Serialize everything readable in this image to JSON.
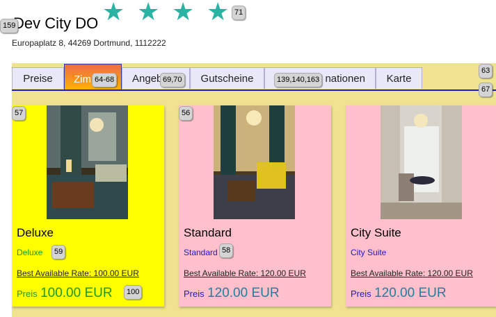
{
  "hotel": {
    "name": "Dev City DO",
    "address": "Europaplatz 8, 44269 Dortmund, 1112222",
    "star_count": 4,
    "star_color": "#2ab3a3"
  },
  "badges": {
    "title": "159",
    "stars": "71",
    "tab_zimmer": "64-68",
    "tab_angebote": "69,70",
    "tab_info": "139,140,163",
    "tabs_right_top": "63",
    "tabs_right_bottom": "67",
    "card1_corner": "57",
    "card2_corner": "56",
    "card1_sub": "59",
    "card2_sub": "58",
    "card1_price": "100"
  },
  "tabs": [
    {
      "label": "Preise"
    },
    {
      "label": "Zimmer",
      "visible_text": "Zim"
    },
    {
      "label": "Angebote",
      "visible_text": "Angeb"
    },
    {
      "label": "Gutscheine"
    },
    {
      "label": "Informationen",
      "visible_text": "nationen"
    },
    {
      "label": "Karte"
    }
  ],
  "rooms": [
    {
      "name": "Deluxe",
      "sub": "Deluxe",
      "rate": "Best Available Rate: 100.00 EUR",
      "price_label": "Preis",
      "price": "100.00 EUR",
      "bg": "#ffff00",
      "sub_color": "#1a9a1a"
    },
    {
      "name": "Standard",
      "sub": "Standard",
      "rate": "Best Available Rate: 120.00 EUR",
      "price_label": "Preis",
      "price": "120.00 EUR",
      "bg": "#ffc0cb",
      "sub_color": "#1a1ac8"
    },
    {
      "name": "City Suite",
      "sub": "City Suite",
      "rate": "Best Available Rate: 120.00 EUR",
      "price_label": "Preis",
      "price": "120.00 EUR",
      "bg": "#ffc0cb",
      "sub_color": "#1a1ac8"
    }
  ],
  "colors": {
    "panel": "#efe38f",
    "tab_active_from": "#f06a48",
    "tab_active_to": "#ffb300",
    "tab_line": "#1a1ac8",
    "price_value": "#1e7fa0"
  }
}
